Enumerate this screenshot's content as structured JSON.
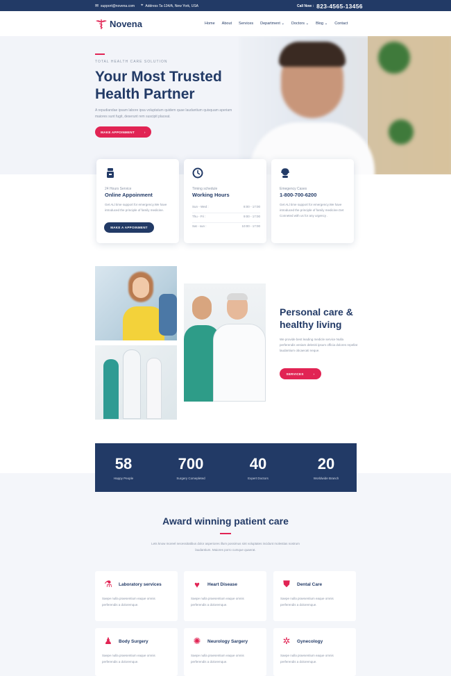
{
  "topbar": {
    "email": "support@novena.com",
    "address": "Address Ta-134/A, New York, USA",
    "call_label": "Call Now :",
    "phone": "823-4565-13456"
  },
  "brand": {
    "name": "Novena",
    "color": "#e12454"
  },
  "nav": [
    "Home",
    "About",
    "Services",
    "Department ⌄",
    "Doctors ⌄",
    "Blog ⌄",
    "Contact"
  ],
  "hero": {
    "kicker": "TOTAL HEALTH CARE SOLUTION",
    "title": "Your Most Trusted Health Partner",
    "desc": "A repudiandae ipsam labore ipsa voluptatum quidem quae laudantium quisquam aperiam maiores sunt fugit, deserunt rem suscipit placeat.",
    "button": "MAKE APPOINMENT",
    "button_arrow": "›"
  },
  "cards": [
    {
      "icon": "support-icon",
      "small": "24 Hours Service",
      "title": "Online Appoinment",
      "text": "Get ALl time support for emergency.We have introduced the principle of family medicine.",
      "button": "MAKE A APPOINMENT"
    },
    {
      "icon": "clock-icon",
      "small": "Timing schedule",
      "title": "Working Hours",
      "hours": [
        {
          "days": "Sun - Wed :",
          "time": "8:00 - 17:00"
        },
        {
          "days": "Thu - Fri :",
          "time": "9:00 - 17:00"
        },
        {
          "days": "Sat - sun :",
          "time": "10:00 - 17:00"
        }
      ]
    },
    {
      "icon": "headset-icon",
      "small": "Emegency Cases",
      "title": "1-800-700-6200",
      "text": "Get ALl time support for emergency.We have introduced the principle of family medicine.Get Conneted with us for any urgency ."
    }
  ],
  "about": {
    "title": "Personal care & healthy living",
    "desc": "We provide best leading medicle service Nulla perferendis veniam deleniti ipsum officia dolores repellat laudantium obcaecati neque.",
    "button": "SERVICES",
    "button_arrow": "›"
  },
  "stats": [
    {
      "num": "58",
      "label": "Happy People"
    },
    {
      "num": "700",
      "label": "Surgery Comepleted"
    },
    {
      "num": "40",
      "label": "Expert Doctors"
    },
    {
      "num": "20",
      "label": "Worldwide Branch"
    }
  ],
  "services_section": {
    "title": "Award winning patient care",
    "desc": "Lets know moreel necessitatibus dolor asperiores illum possimus sint voluptates incidunt molestias nostrum laudantium. Maiores porro cumque quaerat."
  },
  "services": [
    {
      "icon": "flask-icon",
      "glyph": "⚗",
      "title": "Laboratory services",
      "desc": "Saepe nulla praesentium eaque omnis perferendis a doloremque."
    },
    {
      "icon": "heart-icon",
      "glyph": "♥",
      "title": "Heart Disease",
      "desc": "Saepe nulla praesentium eaque omnis perferendis a doloremque."
    },
    {
      "icon": "tooth-icon",
      "glyph": "⛊",
      "title": "Dental Care",
      "desc": "Saepe nulla praesentium eaque omnis perferendis a doloremque."
    },
    {
      "icon": "body-icon",
      "glyph": "♟",
      "title": "Body Surgery",
      "desc": "Saepe nulla praesentium eaque omnis perferendis a doloremque."
    },
    {
      "icon": "brain-icon",
      "glyph": "✺",
      "title": "Neurology Sargery",
      "desc": "Saepe nulla praesentium eaque omnis perferendis a doloremque."
    },
    {
      "icon": "dna-icon",
      "glyph": "✲",
      "title": "Gynecology",
      "desc": "Saepe nulla praesentium eaque omnis perferendis a doloremque."
    }
  ]
}
